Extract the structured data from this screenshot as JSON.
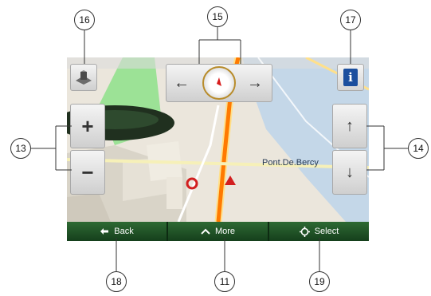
{
  "map": {
    "street_label": "Pont.De.Bercy"
  },
  "controls": {
    "zoom_in_symbol": "+",
    "zoom_out_symbol": "−",
    "rotate_left_symbol": "←",
    "rotate_right_symbol": "→",
    "tilt_up_symbol": "↑",
    "tilt_down_symbol": "↓",
    "info_symbol": "i"
  },
  "bottom_bar": {
    "back_label": "Back",
    "more_label": "More",
    "select_label": "Select"
  },
  "callouts": {
    "zoom": "13",
    "tilt": "14",
    "rotate": "15",
    "view_mode": "16",
    "info": "17",
    "back": "18",
    "more": "11",
    "select": "19"
  },
  "icons": [
    "3d-view-icon",
    "compass-icon",
    "info-icon",
    "back-arrow-icon",
    "chevron-up-icon",
    "crosshair-icon",
    "position-marker-icon"
  ],
  "colors": {
    "bottom_bar": "#1f5a26",
    "route": "#ff7a00",
    "water": "#c4d7e8",
    "park": "#8ee08a"
  }
}
